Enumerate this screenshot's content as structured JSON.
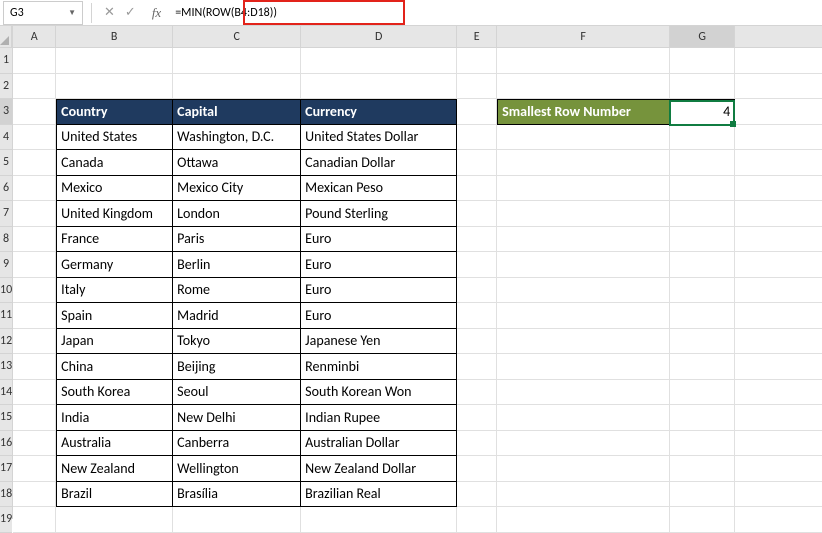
{
  "nameBox": "G3",
  "formula": "=MIN(ROW(B4:D18))",
  "columns": [
    "A",
    "B",
    "C",
    "D",
    "E",
    "F",
    "G"
  ],
  "rowCount": 19,
  "activeRow": 3,
  "activeCol": "G",
  "table": {
    "headers": {
      "country": "Country",
      "capital": "Capital",
      "currency": "Currency"
    },
    "rows": [
      {
        "country": "United States",
        "capital": "Washington, D.C.",
        "currency": "United States Dollar"
      },
      {
        "country": "Canada",
        "capital": "Ottawa",
        "currency": "Canadian Dollar"
      },
      {
        "country": "Mexico",
        "capital": "Mexico City",
        "currency": "Mexican Peso"
      },
      {
        "country": "United Kingdom",
        "capital": "London",
        "currency": "Pound Sterling"
      },
      {
        "country": "France",
        "capital": "Paris",
        "currency": "Euro"
      },
      {
        "country": "Germany",
        "capital": "Berlin",
        "currency": "Euro"
      },
      {
        "country": "Italy",
        "capital": "Rome",
        "currency": "Euro"
      },
      {
        "country": "Spain",
        "capital": "Madrid",
        "currency": "Euro"
      },
      {
        "country": "Japan",
        "capital": "Tokyo",
        "currency": "Japanese Yen"
      },
      {
        "country": "China",
        "capital": "Beijing",
        "currency": "Renminbi"
      },
      {
        "country": "South Korea",
        "capital": "Seoul",
        "currency": "South Korean Won"
      },
      {
        "country": "India",
        "capital": "New Delhi",
        "currency": "Indian Rupee"
      },
      {
        "country": "Australia",
        "capital": "Canberra",
        "currency": "Australian Dollar"
      },
      {
        "country": "New Zealand",
        "capital": "Wellington",
        "currency": "New Zealand Dollar"
      },
      {
        "country": "Brazil",
        "capital": "Brasília",
        "currency": "Brazilian Real"
      }
    ]
  },
  "result": {
    "label": "Smallest Row Number",
    "value": "4"
  }
}
